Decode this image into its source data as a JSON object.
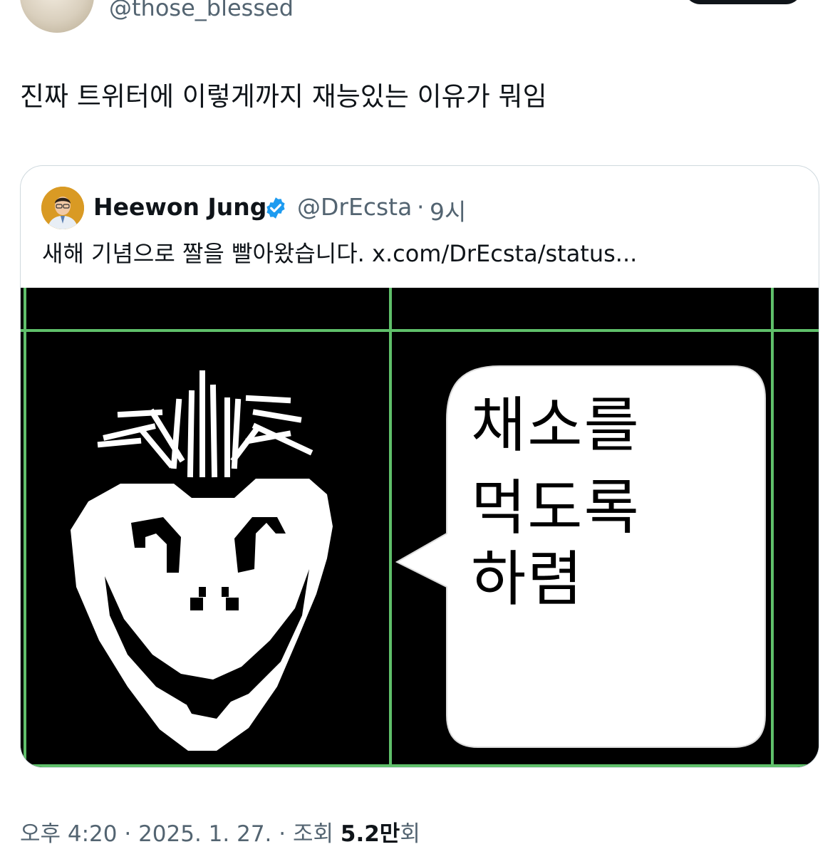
{
  "author": {
    "handle": "@those_blessed",
    "avatar_icon": "avatar-photo"
  },
  "tweet": {
    "text": "진짜 트위터에 이렇게까지 재능있는 이유가 뭐임"
  },
  "quoted": {
    "name": "Heewon Jung",
    "verified_icon": "verified-badge-icon",
    "handle": "@DrEcsta",
    "separator": "·",
    "time": "9시",
    "text": "새해 기념으로 짤을  빨아왔습니다. x.com/DrEcsta/status...",
    "image": {
      "speech_line1": "채소를",
      "speech_line2": "먹도록",
      "speech_line3": "하렴"
    }
  },
  "meta": {
    "time": "오후 4:20",
    "sep1": " · ",
    "date": "2025. 1. 27.",
    "sep2": " · ",
    "views_label": "조회 ",
    "views_count": "5.2만",
    "views_unit": "회"
  },
  "colors": {
    "secondary_text": "#536471",
    "verified_blue": "#1d9bf0",
    "grid_green": "#5fbf6a",
    "border": "#cfd9de"
  }
}
